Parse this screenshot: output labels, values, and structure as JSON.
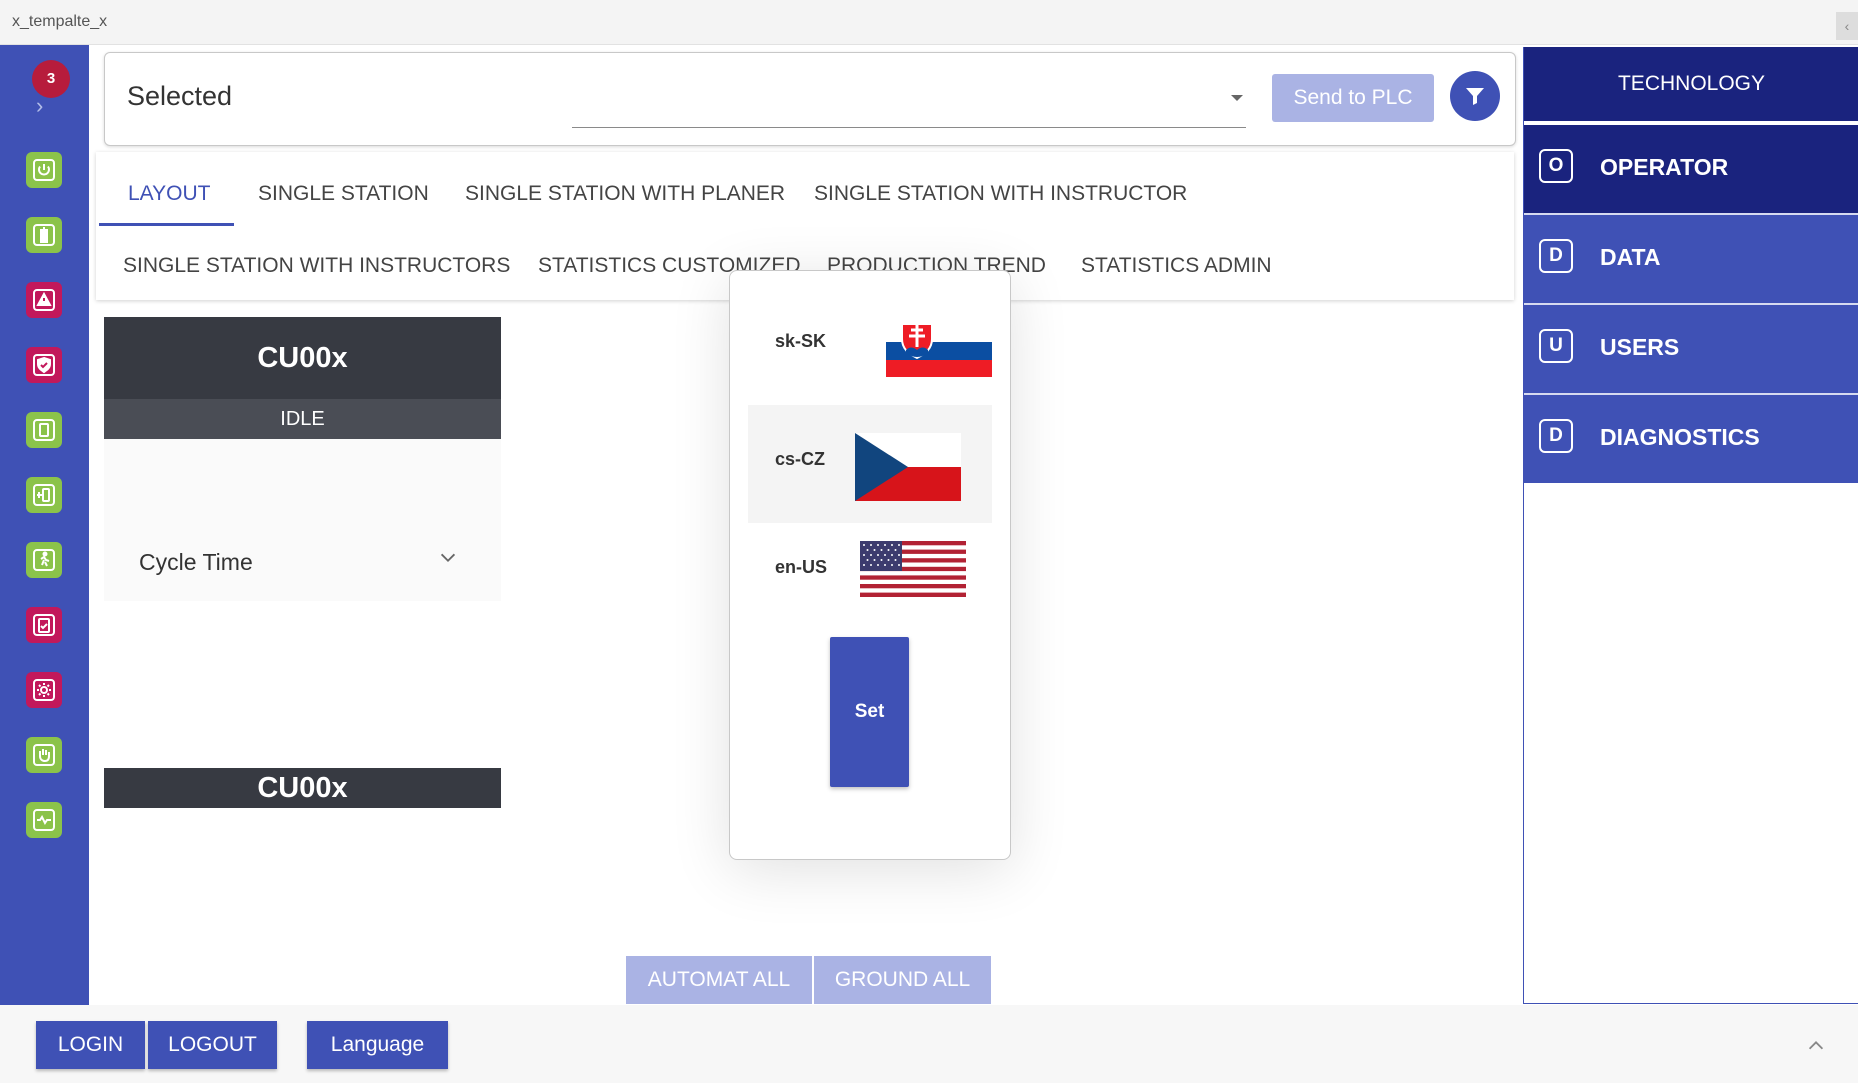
{
  "window": {
    "title": "x_tempalte_x",
    "corner_button": "‹"
  },
  "sidebar": {
    "notification_count": "3",
    "icons": [
      {
        "name": "power-icon",
        "color": "green"
      },
      {
        "name": "battery-icon",
        "color": "green"
      },
      {
        "name": "warning-icon",
        "color": "red"
      },
      {
        "name": "shield-check-icon",
        "color": "red"
      },
      {
        "name": "device-icon",
        "color": "green"
      },
      {
        "name": "device-transfer-icon",
        "color": "green"
      },
      {
        "name": "running-person-icon",
        "color": "green"
      },
      {
        "name": "clipboard-check-icon",
        "color": "red"
      },
      {
        "name": "gear-icon",
        "color": "red"
      },
      {
        "name": "hand-stop-icon",
        "color": "green"
      },
      {
        "name": "heart-pulse-icon",
        "color": "green"
      }
    ]
  },
  "top": {
    "selected_label": "Selected",
    "send_label": "Send to PLC"
  },
  "tabs": {
    "row1": [
      "LAYOUT",
      "SINGLE STATION",
      "SINGLE STATION WITH PLANER",
      "SINGLE STATION WITH INSTRUCTOR"
    ],
    "row2": [
      "SINGLE STATION WITH  INSTRUCTORS",
      "STATISTICS CUSTOMIZED",
      "PRODUCTION TREND",
      "STATISTICS ADMIN"
    ],
    "active": "LAYOUT"
  },
  "station": {
    "name": "CU00x",
    "status": "IDLE",
    "cycle_label": "Cycle Time",
    "name2": "CU00x"
  },
  "language_popup": {
    "languages": [
      {
        "code": "sk-SK",
        "flag": "slovakia-flag"
      },
      {
        "code": "cs-CZ",
        "flag": "czech-flag"
      },
      {
        "code": "en-US",
        "flag": "usa-flag"
      }
    ],
    "selected": "cs-CZ",
    "set_label": "Set"
  },
  "actions": {
    "automat_all": "AUTOMAT ALL",
    "ground_all": "GROUND ALL"
  },
  "right_nav": {
    "header": "TECHNOLOGY",
    "items": [
      {
        "letter": "O",
        "label": "OPERATOR"
      },
      {
        "letter": "D",
        "label": "DATA"
      },
      {
        "letter": "U",
        "label": "USERS"
      },
      {
        "letter": "D",
        "label": "DIAGNOSTICS"
      }
    ]
  },
  "bottom": {
    "login": "LOGIN",
    "logout": "LOGOUT",
    "language": "Language"
  },
  "colors": {
    "primary": "#3f51b5",
    "primary_dark": "#1a237e",
    "disabled": "#aab3e4",
    "green_icon": "#8bc34a",
    "red_icon": "#c2185b",
    "badge": "#b71c3c",
    "station_header": "#373a42"
  }
}
